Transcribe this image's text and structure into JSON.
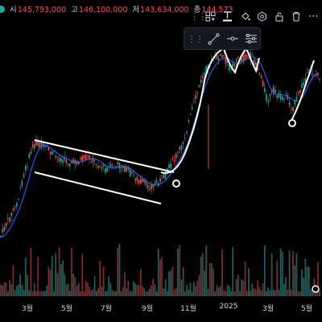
{
  "ohlc": {
    "open_label": "시",
    "open_value": "145,793,000",
    "high_label": "고",
    "high_value": "146,100,000",
    "low_label": "저",
    "low_value": "143,634,000",
    "close_label": "종",
    "close_value": "144,573"
  },
  "toolbar": {
    "handle_icon": "drag-handle-icon",
    "buttons": [
      "layout-icon",
      "text-icon",
      "fill-icon",
      "settings-hexagon-icon",
      "lock-icon",
      "trash-icon",
      "more-icon"
    ]
  },
  "subtoolbar": {
    "buttons": [
      "line-icon",
      "line-point-icon",
      "line-settings-icon"
    ]
  },
  "x_axis": {
    "labels": [
      "3월",
      "5월",
      "7월",
      "9월",
      "11월",
      "2025",
      "3월",
      "5월"
    ]
  },
  "colors": {
    "background": "#000000",
    "up": "#26a69a",
    "down": "#ef5350",
    "ma_line": "#2962ff",
    "drawing": "#ffffff"
  },
  "chart_data": {
    "type": "candlestick",
    "x_tick_labels": [
      "3월",
      "5월",
      "7월",
      "9월",
      "11월",
      "2025",
      "3월",
      "5월"
    ],
    "overlay": "moving-average",
    "drawings": [
      "parallel-channel",
      "trend-curves",
      "marker-points"
    ],
    "grid": false
  }
}
